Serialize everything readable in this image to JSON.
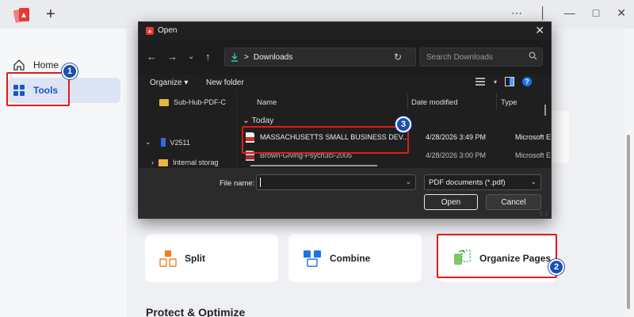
{
  "app": {
    "window_controls": [
      "⋯",
      "│",
      "—",
      "□",
      "✕"
    ],
    "new_tab": "+"
  },
  "sidebar": {
    "items": [
      {
        "label": "Home",
        "icon": "home-icon"
      },
      {
        "label": "Tools",
        "icon": "tools-grid-icon",
        "active": true
      }
    ]
  },
  "main": {
    "cards": [
      {
        "label": "Split",
        "icon": "split-icon"
      },
      {
        "label": "Combine",
        "icon": "combine-icon"
      },
      {
        "label": "Organize Pages",
        "icon": "organize-pages-icon"
      }
    ],
    "section_title": "Protect & Optimize"
  },
  "callouts": [
    "1",
    "2",
    "3"
  ],
  "dialog": {
    "title": "Open",
    "close": "✕",
    "address": "Downloads",
    "address_sep": ">",
    "search_placeholder": "Search Downloads",
    "toolbar": {
      "organize": "Organize ▾",
      "new_folder": "New folder"
    },
    "tree": [
      {
        "label": "Sub-Hub-PDF-C",
        "icon": "folder-icon"
      },
      {
        "label": "V2511",
        "icon": "device-icon",
        "expander": "⌄"
      },
      {
        "label": "Internal storag",
        "icon": "folder-icon",
        "expander": "›"
      }
    ],
    "columns": {
      "name": "Name",
      "date": "Date modified",
      "type": "Type"
    },
    "group": "⌄ Today",
    "files": [
      {
        "name": "MASSACHUSETTS SMALL BUSINESS DEV...",
        "date": "4/28/2026 3:49 PM",
        "type": "Microsoft Ec"
      },
      {
        "name": "Brown-Giving-Psych3ci-2005",
        "date": "4/28/2026 3:00 PM",
        "type": "Microsoft Ec"
      }
    ],
    "file_name_label": "File name:",
    "file_name_value": "",
    "file_type": "PDF documents (*.pdf)",
    "open_label": "Open",
    "cancel_label": "Cancel"
  },
  "colors": {
    "accent": "#1a56c7",
    "callout": "#e21b1b",
    "badge": "#1d4fb0"
  }
}
